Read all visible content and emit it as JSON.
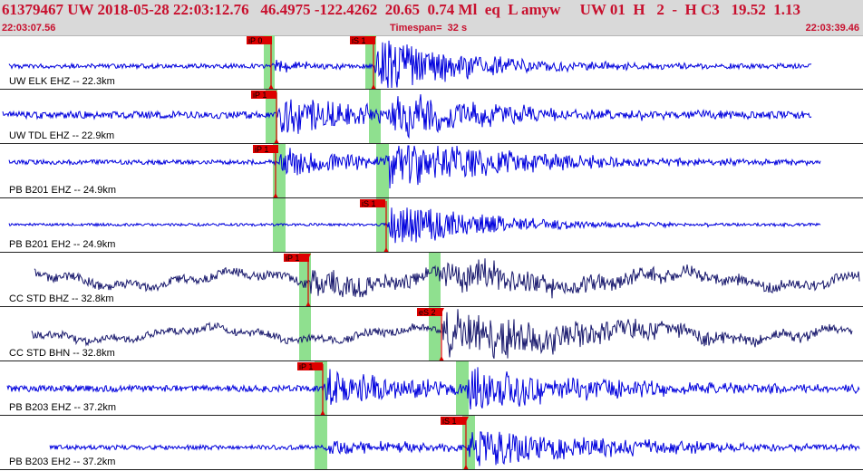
{
  "header": {
    "title": "61379467 UW 2018-05-28 22:03:12.76   46.4975 -122.4262  20.65  0.74 Ml  eq  L amyw     UW 01  H   2  -  H C3   19.52  1.13",
    "start_time": "22:03:07.56",
    "timespan": "Timespan=  32 s",
    "end_time": "22:03:39.46"
  },
  "colors": {
    "trace_blue": "#0000dd",
    "trace_navy": "#1a1a6e",
    "pick_red": "#dd0000",
    "window_green": "#8fe08f",
    "divider": "#222222"
  },
  "traces": [
    {
      "label": "UW ELK EHZ -- 22.3km",
      "color": "blue",
      "picks": [
        {
          "text": "iP 0",
          "marker": false
        },
        {
          "text": "iS 1",
          "marker": true
        }
      ]
    },
    {
      "label": "UW TDL EHZ -- 22.9km",
      "color": "blue",
      "picks": [
        {
          "text": "iP 1",
          "marker": false
        }
      ]
    },
    {
      "label": "PB B201 EHZ -- 24.9km",
      "color": "blue",
      "picks": [
        {
          "text": "iP 1",
          "marker": false
        }
      ]
    },
    {
      "label": "PB B201 EH2 -- 24.9km",
      "color": "blue",
      "picks": [
        {
          "text": "iS 1",
          "marker": false
        }
      ]
    },
    {
      "label": "CC STD BHZ -- 32.8km",
      "color": "navy",
      "picks": [
        {
          "text": "iP 1",
          "marker": true
        }
      ]
    },
    {
      "label": "CC STD BHN -- 32.8km",
      "color": "navy",
      "picks": [
        {
          "text": "eS 2",
          "marker": true
        }
      ]
    },
    {
      "label": "PB B203 EHZ -- 37.2km",
      "color": "blue",
      "picks": [
        {
          "text": "iP 1",
          "marker": false
        }
      ]
    },
    {
      "label": "PB B203 EH2 -- 37.2km",
      "color": "blue",
      "picks": [
        {
          "text": "iS 1",
          "marker": true
        }
      ]
    }
  ]
}
